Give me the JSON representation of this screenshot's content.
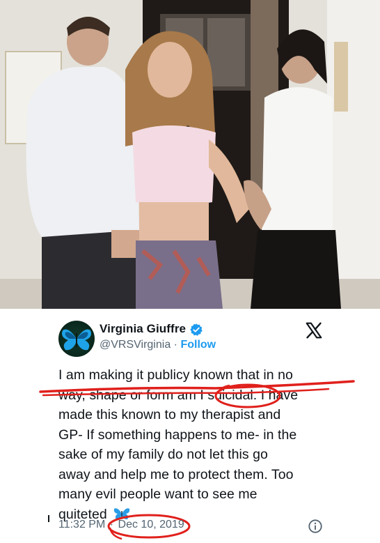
{
  "tweet": {
    "author_name": "Virginia Giuffre",
    "handle": "@VRSVirginia",
    "separator": "·",
    "follow_label": "Follow",
    "body_lines": [
      "I am making it publicy known that in no",
      "way, shape or form am I suicidal. I have",
      "made this known to my therapist and",
      "GP- If something happens to me- in the",
      "sake of my family do not let this go",
      "away and help me to protect them. Too",
      "many evil people want to see me",
      "quiteted"
    ],
    "time": "11:32 PM",
    "date_separator": "·",
    "date": "Dec 10, 2019"
  },
  "icons": {
    "verified": "verified-badge-icon",
    "platform": "x-logo-icon",
    "info": "info-icon",
    "emoji": "butterfly-emoji-icon"
  },
  "colors": {
    "accent": "#1d9bf0",
    "annotation": "#e0201c",
    "secondary_text": "#536471"
  }
}
